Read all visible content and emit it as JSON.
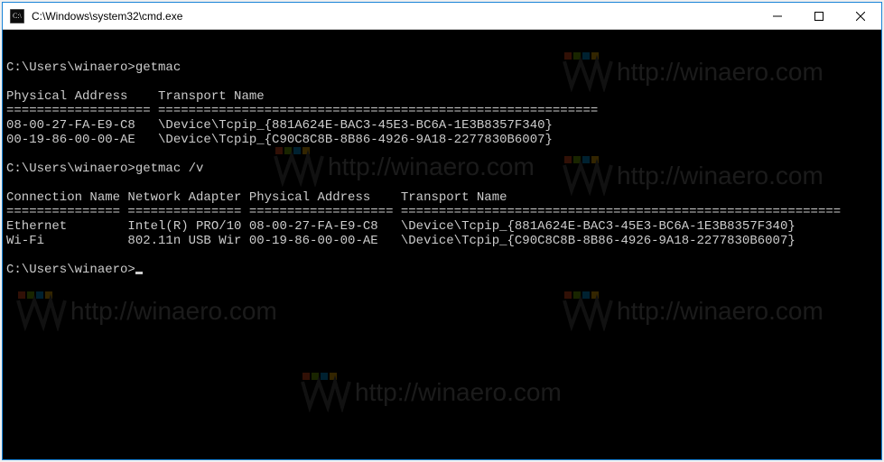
{
  "window": {
    "title": "C:\\Windows\\system32\\cmd.exe"
  },
  "prompts": {
    "p1": "C:\\Users\\winaero>",
    "cmd1": "getmac",
    "cmd2": "getmac /v"
  },
  "output1": {
    "header": "Physical Address    Transport Name",
    "sep": "=================== ==========================================================",
    "row1": "08-00-27-FA-E9-C8   \\Device\\Tcpip_{881A624E-BAC3-45E3-BC6A-1E3B8357F340}",
    "row2": "00-19-86-00-00-AE   \\Device\\Tcpip_{C90C8C8B-8B86-4926-9A18-2277830B6007}"
  },
  "output2": {
    "header": "Connection Name Network Adapter Physical Address    Transport Name",
    "sep": "=============== =============== =================== ==========================================================",
    "row1": "Ethernet        Intel(R) PRO/10 08-00-27-FA-E9-C8   \\Device\\Tcpip_{881A624E-BAC3-45E3-BC6A-1E3B8357F340}",
    "row2": "Wi-Fi           802.11n USB Wir 00-19-86-00-00-AE   \\Device\\Tcpip_{C90C8C8B-8B86-4926-9A18-2277830B6007}"
  },
  "watermark": "http://winaero.com"
}
